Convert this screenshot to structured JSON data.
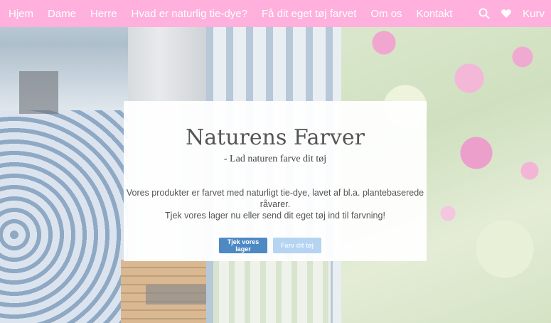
{
  "nav": {
    "links": [
      "Hjem",
      "Dame",
      "Herre",
      "Hvad er naturlig tie-dye?",
      "Få dit eget tøj farvet",
      "Om os",
      "Kontakt"
    ],
    "search_icon": "search-icon",
    "wishlist_icon": "heart-icon",
    "cart_label": "Kurv"
  },
  "hero": {
    "title": "Naturens Farver",
    "subtitle": "- Lad naturen farve dit tøj",
    "text_line1": "Vores produkter er farvet med naturligt tie-dye, lavet af bl.a. plantebaserede råvarer.",
    "text_line2": "Tjek vores lager nu eller send dit eget tøj ind til farvning!",
    "primary_button": "Tjek vores lager",
    "secondary_button": "Farv dit tøj"
  },
  "colors": {
    "nav_bg": "#ffb0dc",
    "primary_button": "#4e89c4",
    "secondary_button": "#b5d4f2"
  }
}
